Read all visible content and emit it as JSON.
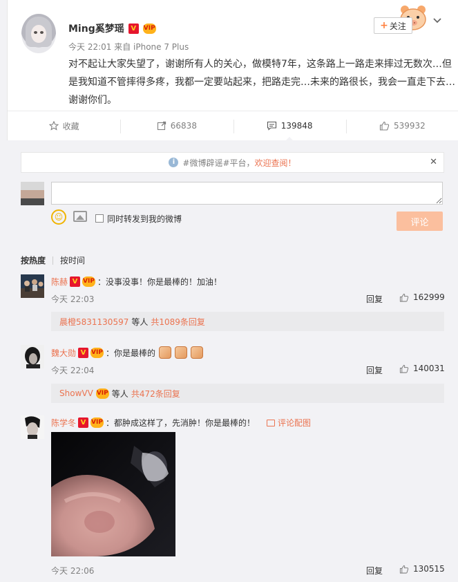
{
  "post": {
    "author": "Ming奚梦瑶",
    "meta": "今天 22:01 来自 iPhone 7 Plus",
    "text": "对不起让大家失望了，谢谢所有人的关心，做模特7年，这条路上一路走来摔过无数次…但是我知道不管摔得多疼，我都一定要站起来，把路走完…未来的路很长，我会一直走下去…谢谢你们。",
    "follow_label": "关注",
    "follow_plus": "+",
    "actions": {
      "favorite": "收藏",
      "repost": "66838",
      "comment": "139848",
      "like": "539932"
    }
  },
  "notice": {
    "prefix": "#微博辟谣#平台，",
    "link": "欢迎查阅！",
    "close": "✕"
  },
  "composer": {
    "input_placeholder": "",
    "repost_label": "同时转发到我的微博",
    "submit_label": "评论"
  },
  "sort": {
    "hot": "按热度",
    "time": "按时间"
  },
  "badges": {
    "v": "V",
    "vip": "VIP"
  },
  "comments": [
    {
      "name": "陈赫",
      "text": "：没事没事！你是最棒的！加油！",
      "time": "今天 22:03",
      "reply": "回复",
      "likes": "162999",
      "sub_user": "晨橙5831130597",
      "sub_mid": "等人",
      "sub_link": "共1089条回复"
    },
    {
      "name": "魏大勋",
      "text": "：你是最棒的",
      "time": "今天 22:04",
      "reply": "回复",
      "likes": "140031",
      "sub_user": "ShowVV",
      "sub_mid": "等人",
      "sub_link": "共472条回复"
    },
    {
      "name": "陈学冬",
      "text": "：都肿成这样了，先消肿！你是最棒的！",
      "pic_label": "评论配图",
      "time": "今天 22:06",
      "reply": "回复",
      "likes": "130515"
    }
  ],
  "colors": {
    "accent": "#eb7350",
    "submit_bg": "#fbbf9e",
    "page_bg": "#f2f2f5"
  }
}
